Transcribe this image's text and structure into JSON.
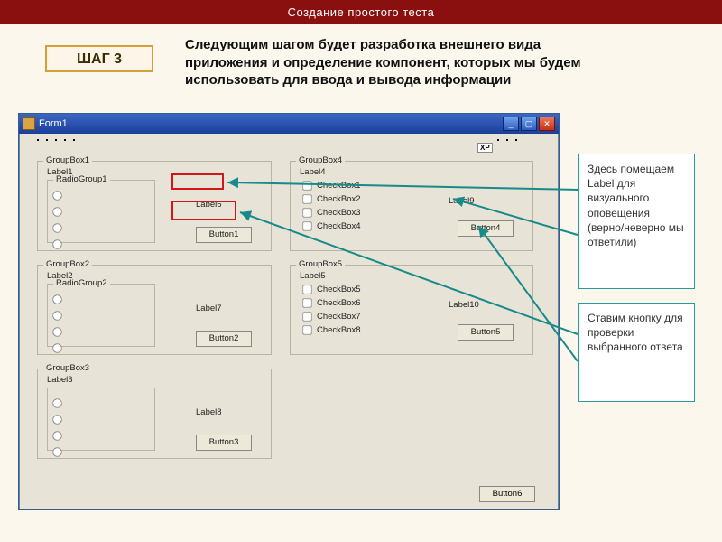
{
  "header": {
    "title": "Создание простого теста"
  },
  "step": {
    "label": "ШАГ 3"
  },
  "lead": "Следующим шагом будет разработка внешнего вида приложения и определение компонент, которых мы будем использовать для ввода и вывода информации",
  "notes": {
    "label_note": "Здесь помещаем Label для визуального оповещения (верно/неверно мы ответили)",
    "button_note": "Ставим кнопку для проверки выбранного ответа"
  },
  "window": {
    "title": "Form1",
    "xp_badge": "XP",
    "groupboxes": {
      "gb1": {
        "title": "GroupBox1",
        "label": "Label1",
        "radiogroup": "RadioGroup1",
        "inner_label": "Label6",
        "button": "Button1"
      },
      "gb2": {
        "title": "GroupBox2",
        "label": "Label2",
        "radiogroup": "RadioGroup2",
        "inner_label": "Label7",
        "button": "Button2"
      },
      "gb3": {
        "title": "GroupBox3",
        "label": "Label3",
        "inner_label": "Label8",
        "button": "Button3"
      },
      "gb4": {
        "title": "GroupBox4",
        "label": "Label4",
        "checks": [
          "CheckBox1",
          "CheckBox2",
          "CheckBox3",
          "CheckBox4"
        ],
        "side_label": "Label9",
        "button": "Button4"
      },
      "gb5": {
        "title": "GroupBox5",
        "label": "Label5",
        "checks": [
          "CheckBox5",
          "CheckBox6",
          "CheckBox7",
          "CheckBox8"
        ],
        "side_label": "Label10",
        "button": "Button5"
      }
    },
    "bottom_button": "Button6"
  }
}
